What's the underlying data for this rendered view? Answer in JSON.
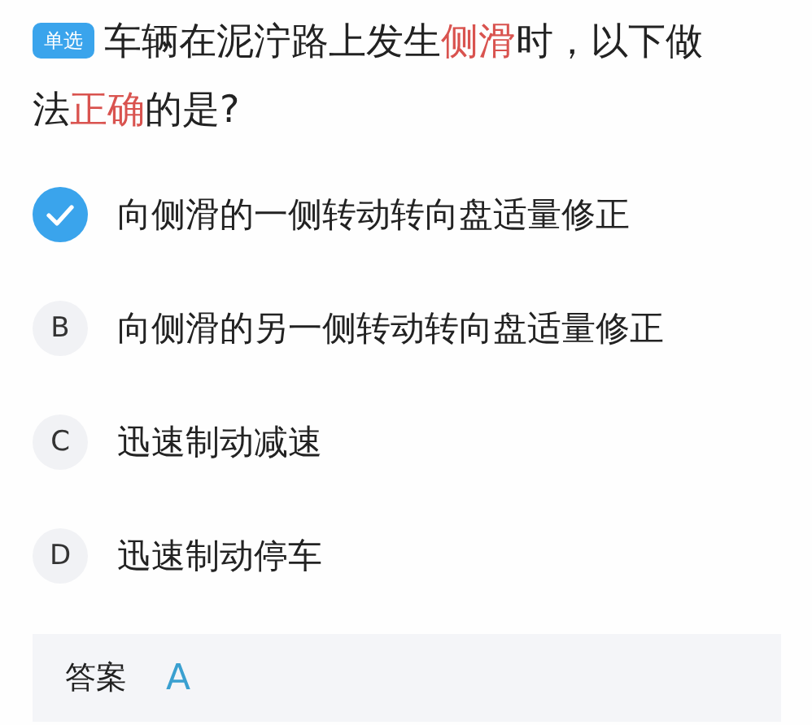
{
  "question": {
    "badge": "单选",
    "segments": [
      {
        "text": "车辆在泥泞路上发生",
        "highlight": false
      },
      {
        "text": "侧滑",
        "highlight": true
      },
      {
        "text": "时，以下做法",
        "highlight": false
      },
      {
        "text": "正确",
        "highlight": true
      },
      {
        "text": "的是?",
        "highlight": false
      }
    ]
  },
  "options": [
    {
      "text": "向侧滑的一侧转动转向盘适量修正",
      "selected": true
    },
    {
      "letter": "B",
      "text": "向侧滑的另一侧转动转向盘适量修正",
      "selected": false
    },
    {
      "letter": "C",
      "text": "迅速制动减速",
      "selected": false
    },
    {
      "letter": "D",
      "text": "迅速制动停车",
      "selected": false
    }
  ],
  "answer": {
    "label": "答案",
    "value": "A"
  }
}
